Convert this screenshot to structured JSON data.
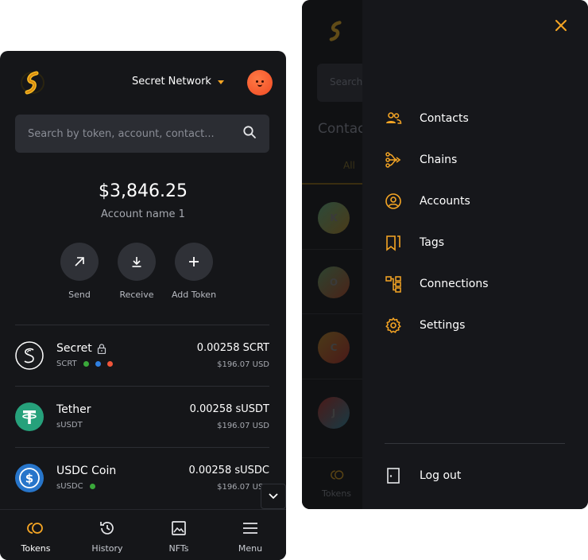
{
  "wallet": {
    "network": "Secret Network",
    "search_placeholder": "Search by token, account, contact...",
    "balance": "$3,846.25",
    "account_name": "Account name 1",
    "actions": [
      {
        "label": "Send",
        "icon": "arrow-up-right-icon"
      },
      {
        "label": "Receive",
        "icon": "download-icon"
      },
      {
        "label": "Add Token",
        "icon": "plus-icon"
      }
    ],
    "tokens": [
      {
        "name": "Secret",
        "symbol": "SCRT",
        "amount": "0.00258 SCRT",
        "usd": "$196.07 USD",
        "locked": true,
        "dots": [
          "#3aa83a",
          "#2f7fe0",
          "#f0553a"
        ],
        "icon": "secret-token-icon"
      },
      {
        "name": "Tether",
        "symbol": "sUSDT",
        "amount": "0.00258 sUSDT",
        "usd": "$196.07 USD",
        "locked": false,
        "dots": [],
        "icon": "tether-token-icon"
      },
      {
        "name": "USDC Coin",
        "symbol": "sUSDC",
        "amount": "0.00258 sUSDC",
        "usd": "$196.07 USD",
        "locked": false,
        "dots": [
          "#3aa83a"
        ],
        "icon": "usdc-token-icon"
      }
    ],
    "nav": [
      {
        "label": "Tokens",
        "icon": "tokens-icon",
        "active": true
      },
      {
        "label": "History",
        "icon": "history-icon",
        "active": false
      },
      {
        "label": "NFTs",
        "icon": "image-icon",
        "active": false
      },
      {
        "label": "Menu",
        "icon": "hamburger-icon",
        "active": false
      }
    ]
  },
  "background_page": {
    "search_placeholder": "Search",
    "title": "Contac",
    "tab": "All",
    "avatars": [
      "K",
      "O",
      "C",
      "J"
    ],
    "nav_label": "Tokens"
  },
  "menu": {
    "items": [
      {
        "label": "Contacts",
        "icon": "contacts-icon"
      },
      {
        "label": "Chains",
        "icon": "chains-icon"
      },
      {
        "label": "Accounts",
        "icon": "account-icon"
      },
      {
        "label": "Tags",
        "icon": "tags-icon"
      },
      {
        "label": "Connections",
        "icon": "connections-icon"
      },
      {
        "label": "Settings",
        "icon": "settings-icon"
      }
    ],
    "logout": "Log out"
  },
  "colors": {
    "accent": "#f5a524",
    "panel": "#151619",
    "drawer": "#16171b"
  }
}
